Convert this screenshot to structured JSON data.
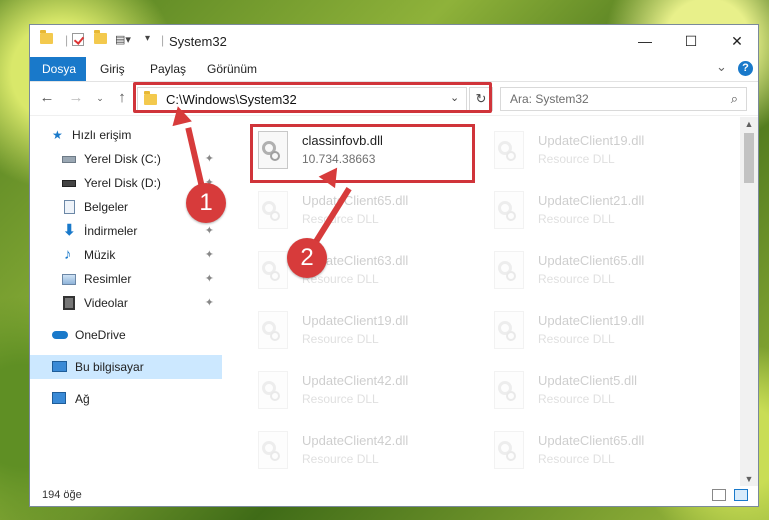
{
  "window": {
    "title": "System32",
    "controls": {
      "minimize": "—",
      "maximize": "☐",
      "close": "✕"
    }
  },
  "ribbon": {
    "tabs": [
      {
        "label": "Dosya",
        "active": true
      },
      {
        "label": "Giriş"
      },
      {
        "label": "Paylaş"
      },
      {
        "label": "Görünüm"
      }
    ],
    "expand_icon": "⌄",
    "help_icon": "?"
  },
  "address": {
    "path": "C:\\Windows\\System32",
    "search_placeholder": "Ara: System32"
  },
  "sidebar": {
    "items": [
      {
        "label": "Hızlı erişim",
        "icon": "star-icon"
      },
      {
        "label": "Yerel Disk (C:)",
        "icon": "drive-icon",
        "pinned": true
      },
      {
        "label": "Yerel Disk (D:)",
        "icon": "drive-icon",
        "pinned": true
      },
      {
        "label": "Belgeler",
        "icon": "documents-icon",
        "pinned": true
      },
      {
        "label": "İndirmeler",
        "icon": "download-icon",
        "pinned": true
      },
      {
        "label": "Müzik",
        "icon": "music-icon",
        "pinned": true
      },
      {
        "label": "Resimler",
        "icon": "pictures-icon",
        "pinned": true
      },
      {
        "label": "Videolar",
        "icon": "video-icon",
        "pinned": true
      },
      {
        "label": "OneDrive",
        "icon": "cloud-icon"
      },
      {
        "label": "Bu bilgisayar",
        "icon": "computer-icon",
        "selected": true
      },
      {
        "label": "Ağ",
        "icon": "network-icon"
      }
    ]
  },
  "files": {
    "main": {
      "name": "classinfovb.dll",
      "detail": "10.734.38663"
    },
    "ghosts": [
      {
        "name": "UpdateClient19.dll",
        "detail": "Resource DLL"
      },
      {
        "name": "UpdateClient65.dll",
        "detail": "Resource DLL"
      },
      {
        "name": "UpdateClient21.dll",
        "detail": "Resource DLL"
      },
      {
        "name": "UpdateClient63.dll",
        "detail": "Resource DLL"
      },
      {
        "name": "UpdateClient65.dll",
        "detail": "Resource DLL"
      },
      {
        "name": "UpdateClient19.dll",
        "detail": "Resource DLL"
      },
      {
        "name": "UpdateClient19.dll",
        "detail": "Resource DLL"
      },
      {
        "name": "UpdateClient42.dll",
        "detail": "Resource DLL"
      },
      {
        "name": "UpdateClient5.dll",
        "detail": "Resource DLL"
      },
      {
        "name": "UpdateClient42.dll",
        "detail": "Resource DLL"
      },
      {
        "name": "UpdateClient65.dll",
        "detail": "Resource DLL"
      }
    ]
  },
  "status": {
    "count": "194 öğe"
  },
  "annotations": {
    "step1": "1",
    "step2": "2"
  },
  "colors": {
    "accent": "#1979ca",
    "highlight": "#d0343a",
    "selected": "#cce8ff"
  }
}
